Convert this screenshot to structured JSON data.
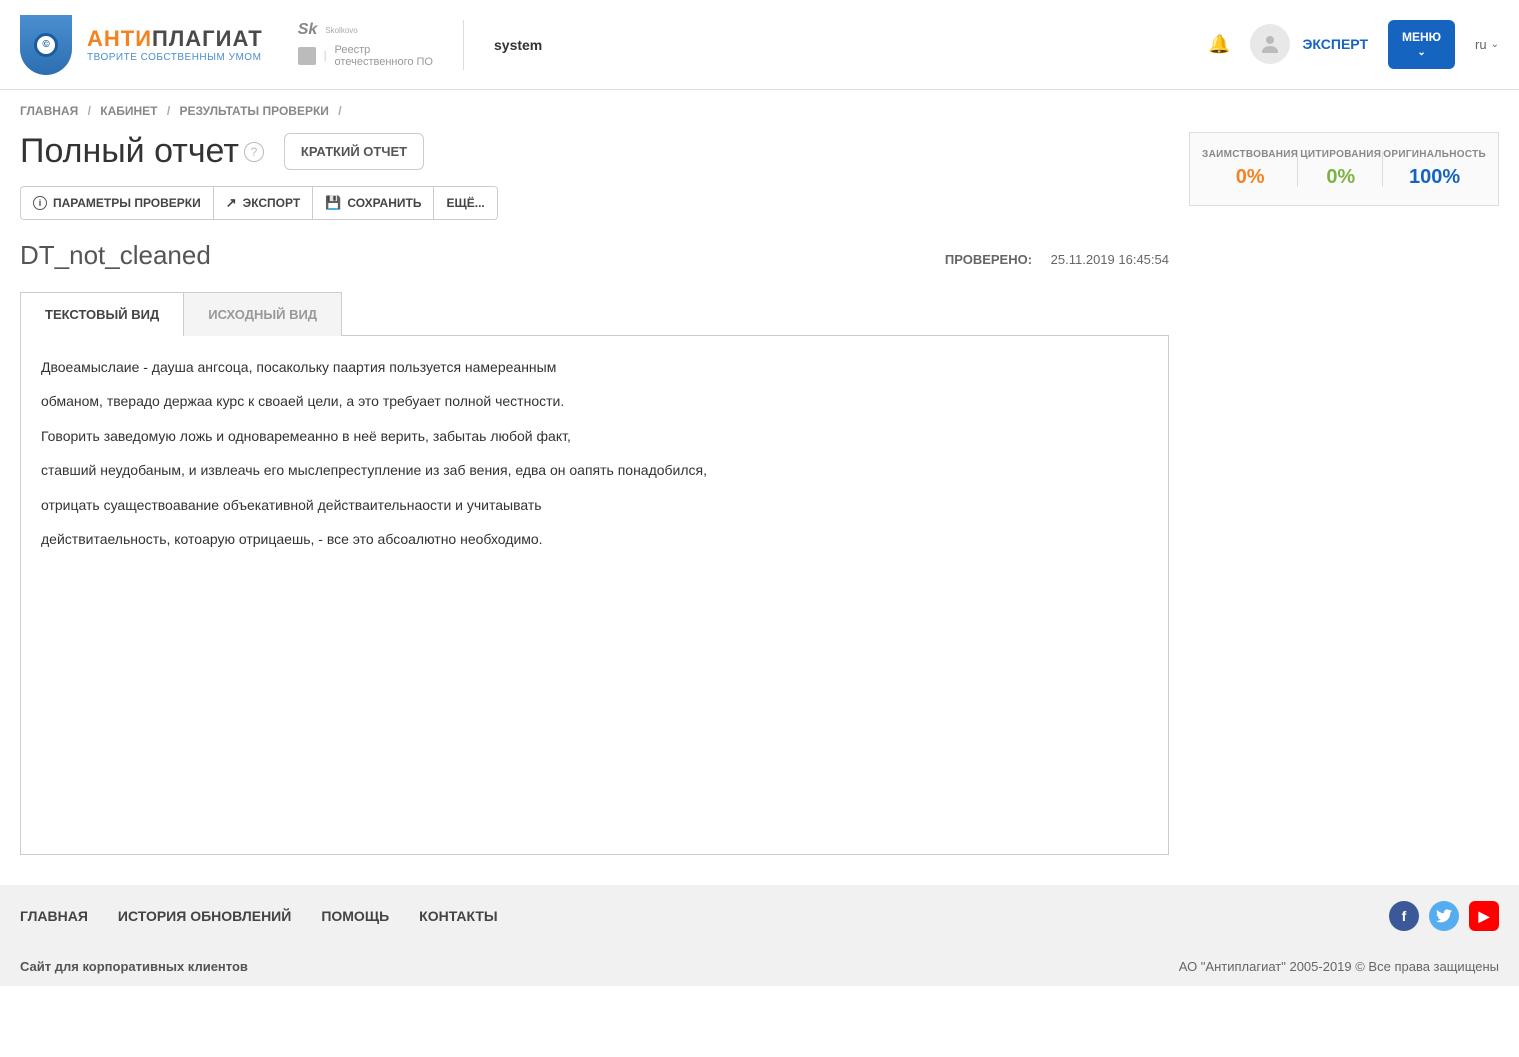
{
  "header": {
    "logo_anti": "АНТИ",
    "logo_plag": "ПЛАГИАТ",
    "logo_sub": "ТВОРИТЕ СОБСТВЕННЫМ УМОМ",
    "sk": "Sk",
    "sk_sub": "Skolkovo",
    "reestr_line1": "Реестр",
    "reestr_line2": "отечественного ПО",
    "system": "system",
    "expert": "ЭКСПЕРТ",
    "menu": "МЕНЮ",
    "lang": "ru"
  },
  "breadcrumbs": {
    "items": [
      "ГЛАВНАЯ",
      "КАБИНЕТ",
      "РЕЗУЛЬТАТЫ ПРОВЕРКИ"
    ]
  },
  "page": {
    "title": "Полный отчет",
    "brief_report": "КРАТКИЙ ОТЧЕТ"
  },
  "toolbar": {
    "params": "ПАРАМЕТРЫ ПРОВЕРКИ",
    "export": "ЭКСПОРТ",
    "save": "СОХРАНИТЬ",
    "more": "ЕЩЁ..."
  },
  "document": {
    "name": "DT_not_cleaned",
    "checked_label": "ПРОВЕРЕНО:",
    "checked_date": "25.11.2019 16:45:54"
  },
  "tabs": {
    "text_view": "ТЕКСТОВЫЙ ВИД",
    "source_view": "ИСХОДНЫЙ ВИД"
  },
  "content": {
    "lines": [
      "Двоеамыслаие - дауша ангсоца, посакольку паартия пользуется намереанным",
      "обманом, тверадо держаа курс к своаей цели, а это требуает полной честности.",
      "Говорить заведомую ложь и одноваремеанно в неё верить, забытаь любой факт,",
      "ставший неудобаным, и извлеачь его мыслепреступление из заб вения, едва он оапять понадобился,",
      "отрицать суаществоавание объекативной действаительнаости и учитаывать",
      "действитаельность, котоарую отрицаешь, - все это абсоалютно необходимо."
    ]
  },
  "stats": {
    "borrow_label": "ЗАИМСТВОВАНИЯ",
    "borrow_value": "0%",
    "cite_label": "ЦИТИРОВАНИЯ",
    "cite_value": "0%",
    "orig_label": "ОРИГИНАЛЬНОСТЬ",
    "orig_value": "100%"
  },
  "footer": {
    "nav": {
      "home": "ГЛАВНАЯ",
      "history": "ИСТОРИЯ ОБНОВЛЕНИЙ",
      "help": "ПОМОЩЬ",
      "contacts": "КОНТАКТЫ"
    },
    "corp": "Сайт для корпоративных клиентов",
    "copyright": "АО \"Антиплагиат\" 2005-2019 © Все права защищены"
  }
}
